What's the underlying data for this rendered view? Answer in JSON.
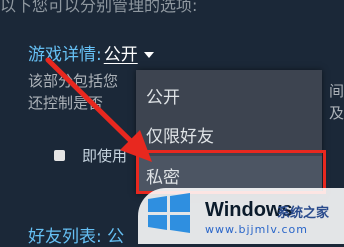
{
  "background": {
    "header_text": "以下您可以分别管理的选项:",
    "detail_label": "游戏详情:",
    "detail_value": "公开",
    "desc_line_1": "该部分包括您",
    "desc_line_2": "还控制是否",
    "desc_right_1": "间",
    "desc_right_2": "及",
    "checkbox_label": "即使用",
    "friends_label": "好友列表: 公"
  },
  "dropdown": {
    "options": [
      "公开",
      "仅限好友",
      "私密"
    ],
    "highlighted": "私密"
  },
  "watermark": {
    "brand": "Windows",
    "brand_cn": "系统之家",
    "url": "www.bjjmlv.com"
  },
  "colors": {
    "panel_bg": "#1b2838",
    "accent": "#66c0f4",
    "dropdown_bg": "#3d4450",
    "highlight": "#e8281f"
  }
}
